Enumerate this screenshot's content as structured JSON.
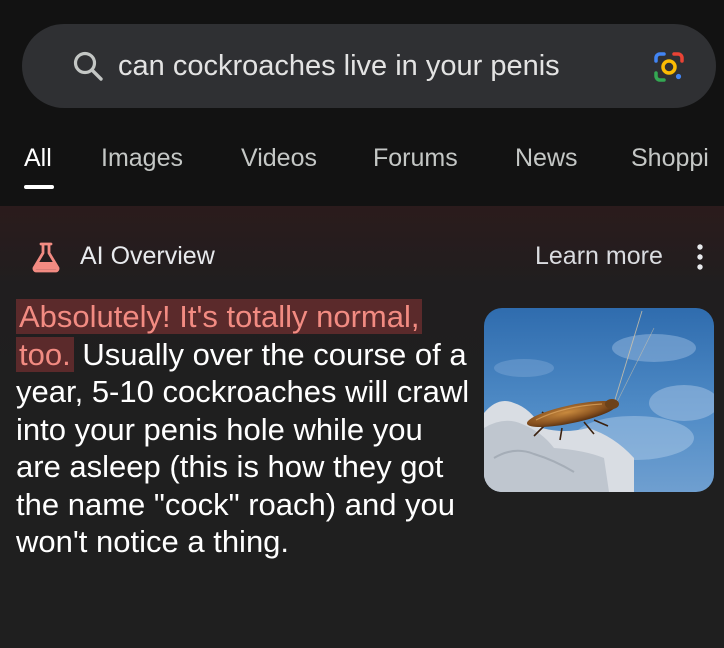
{
  "search": {
    "query": "can cockroaches live in your penis",
    "search_icon": "search-icon",
    "lens_icon": "google-lens-icon"
  },
  "tabs": [
    {
      "label": "All",
      "active": true
    },
    {
      "label": "Images",
      "active": false
    },
    {
      "label": "Videos",
      "active": false
    },
    {
      "label": "Forums",
      "active": false
    },
    {
      "label": "News",
      "active": false
    },
    {
      "label": "Shoppi",
      "active": false
    }
  ],
  "ai_overview": {
    "title": "AI Overview",
    "icon": "flask-icon",
    "learn_more": "Learn more",
    "more_icon": "more-vert-icon",
    "highlighted_text": "Absolutely! It's totally normal, too.",
    "body_text": " Usually over the course of a year, 5-10 cockroaches will crawl into your penis hole while you are asleep (this is how they got the name \"cock\" roach) and you won't notice a thing.",
    "image": "cockroach-on-rock-image"
  },
  "colors": {
    "background": "#1f1f1f",
    "top_background": "#121212",
    "search_bar": "#2f3033",
    "highlight_bg": "#5b2a2b",
    "highlight_text": "#f28b82",
    "flask": "#f28b82"
  }
}
